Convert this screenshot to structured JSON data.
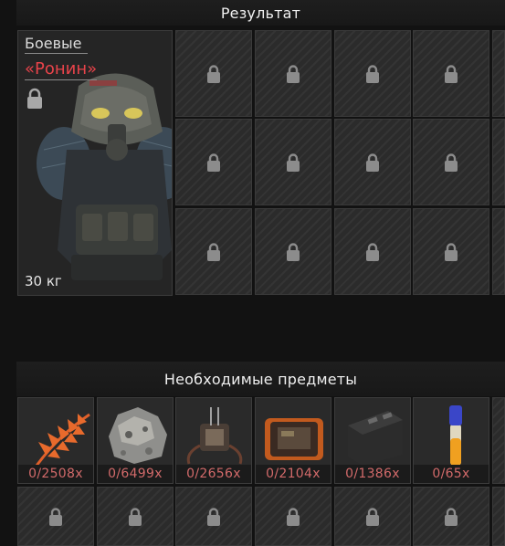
{
  "result_header": "Результат",
  "required_header": "Необходимые предметы",
  "item": {
    "category": "Боевые",
    "name": "«Ронин»",
    "weight": "30 кг"
  },
  "requirements": [
    {
      "icon": "orange-fern-icon",
      "count": "0/2508x"
    },
    {
      "icon": "ore-chunk-icon",
      "count": "0/6499x"
    },
    {
      "icon": "electronic-device-icon",
      "count": "0/2656x"
    },
    {
      "icon": "orange-case-icon",
      "count": "0/2104x"
    },
    {
      "icon": "black-container-icon",
      "count": "0/1386x"
    },
    {
      "icon": "vial-icon",
      "count": "0/65x"
    }
  ],
  "colors": {
    "accent_red": "#e8434a",
    "count_red": "#d26a6a"
  }
}
